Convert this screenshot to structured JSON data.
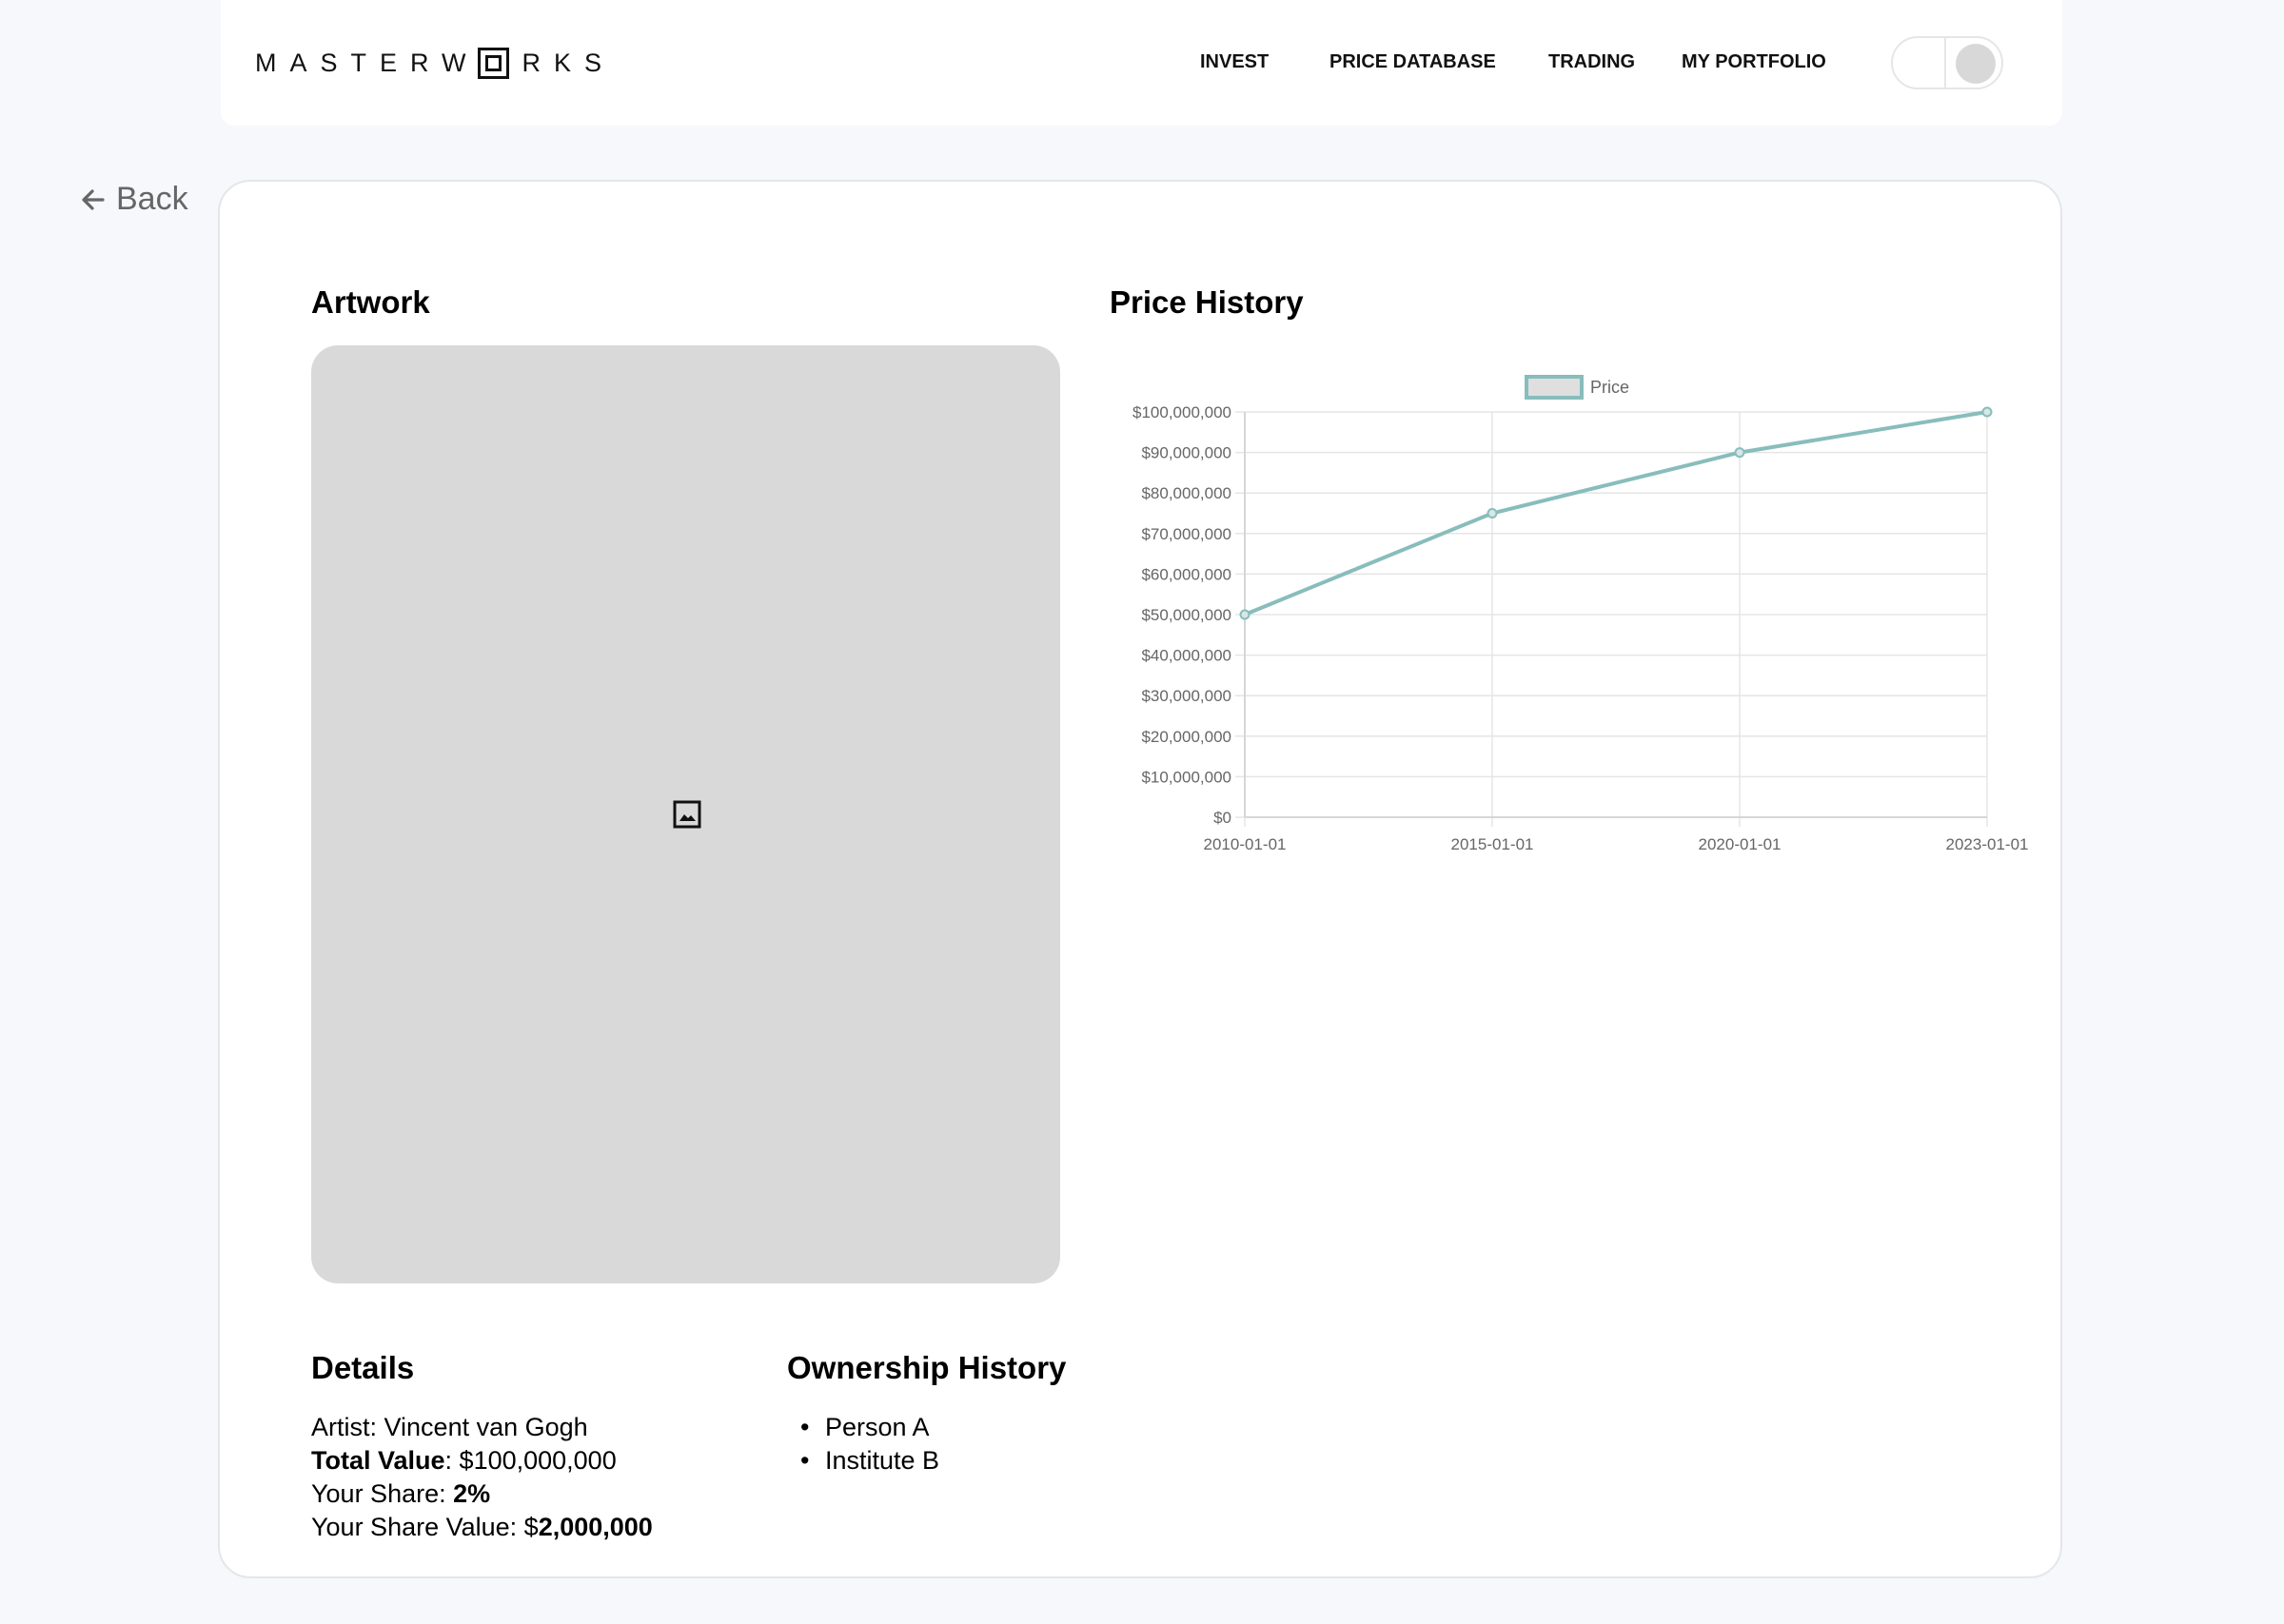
{
  "brand": {
    "logo_text_left": "MASTERW",
    "logo_text_right": "RKS"
  },
  "nav": {
    "invest": "INVEST",
    "price_database": "PRICE DATABASE",
    "trading": "TRADING",
    "my_portfolio": "MY PORTFOLIO"
  },
  "back_label": "Back",
  "artwork": {
    "title": "Artwork",
    "placeholder_icon": "image-icon"
  },
  "price_history": {
    "title": "Price History"
  },
  "details": {
    "title": "Details",
    "artist_label": "Artist: ",
    "artist": "Vincent van Gogh",
    "total_value_label": "Total Value",
    "total_value": ": $100,000,000",
    "share_label": "Your Share: ",
    "share": "2%",
    "share_value_label": "Your Share Value: $",
    "share_value": "2,000,000"
  },
  "ownership": {
    "title": "Ownership History",
    "owners": [
      "Person A",
      "Institute B"
    ]
  },
  "colors": {
    "line": "#88bdbc",
    "grid": "#e5e5e5",
    "axis_text": "#666666"
  },
  "chart_data": {
    "type": "line",
    "legend": "top",
    "x": [
      "2010-01-01",
      "2015-01-01",
      "2020-01-01",
      "2023-01-01"
    ],
    "series": [
      {
        "name": "Price",
        "values": [
          50000000,
          75000000,
          90000000,
          100000000
        ]
      }
    ],
    "ylim": [
      0,
      100000000
    ],
    "yticks": [
      "$0",
      "$10,000,000",
      "$20,000,000",
      "$30,000,000",
      "$40,000,000",
      "$50,000,000",
      "$60,000,000",
      "$70,000,000",
      "$80,000,000",
      "$90,000,000",
      "$100,000,000"
    ],
    "grid": true
  }
}
